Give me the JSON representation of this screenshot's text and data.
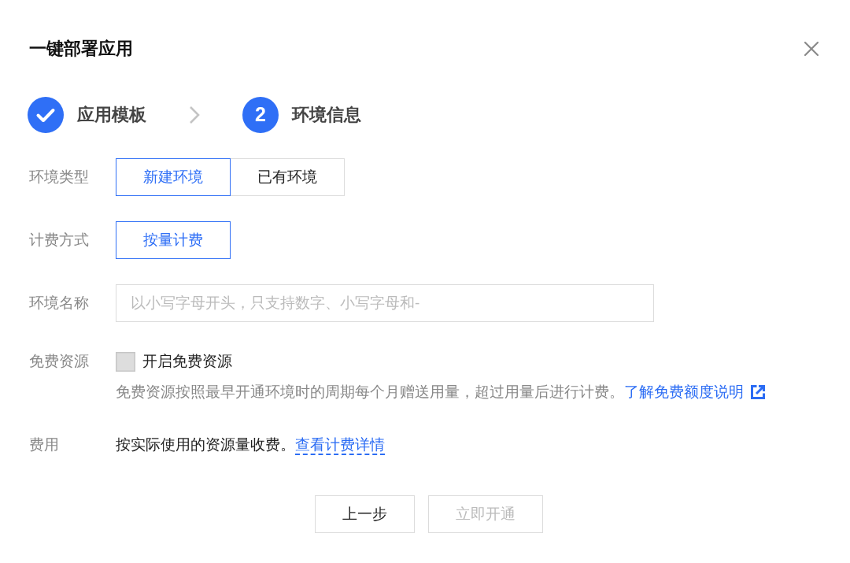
{
  "dialog": {
    "title": "一键部署应用"
  },
  "steps": [
    {
      "label": "应用模板",
      "completed": true
    },
    {
      "number": "2",
      "label": "环境信息",
      "completed": false
    }
  ],
  "form": {
    "rows": [
      {
        "kind": "segmented",
        "label": "环境类型",
        "options": [
          {
            "label": "新建环境",
            "selected": true
          },
          {
            "label": "已有环境",
            "selected": false
          }
        ]
      },
      {
        "kind": "segmented",
        "label": "计费方式",
        "options": [
          {
            "label": "按量计费",
            "selected": true
          }
        ]
      },
      {
        "kind": "input",
        "label": "环境名称",
        "placeholder": "以小写字母开头，只支持数字、小写字母和-"
      },
      {
        "kind": "checkbox",
        "label": "免费资源",
        "option": {
          "label": "开启免费资源",
          "checked": false
        },
        "help": {
          "text": "免费资源按照最早开通环境时的周期每个月赠送用量，超过用量后进行计费。",
          "link": "了解免费额度说明"
        }
      },
      {
        "kind": "text",
        "label": "费用",
        "text": "按实际使用的资源量收费。",
        "link": "查看计费详情"
      }
    ]
  },
  "buttons": [
    {
      "label": "上一步",
      "disabled": false
    },
    {
      "label": "立即开通",
      "disabled": true
    }
  ]
}
